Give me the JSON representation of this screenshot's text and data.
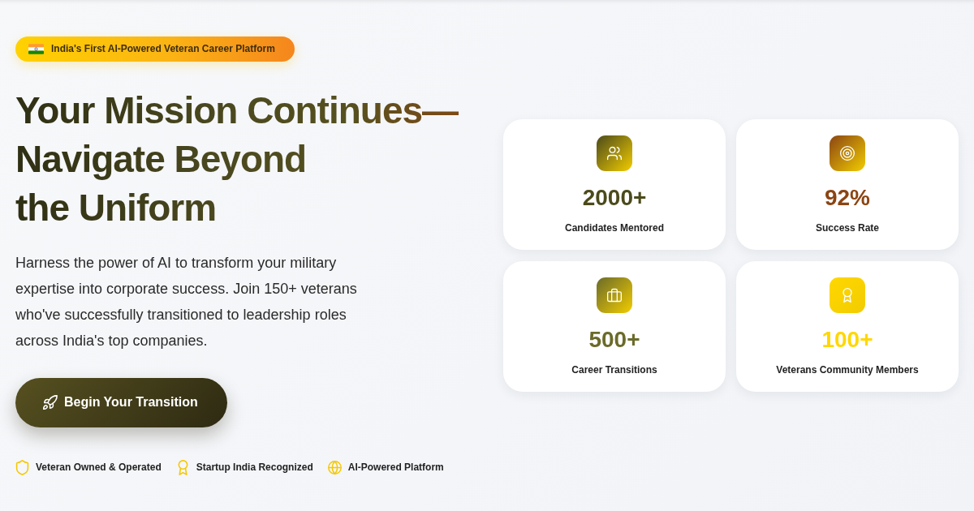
{
  "hero": {
    "badge": {
      "label": "India's First AI-Powered Veteran Career Platform"
    },
    "headline": [
      "Your Mission Continues—",
      "Navigate Beyond",
      "the Uniform"
    ],
    "description": "Harness the power of AI to transform your military expertise into corporate success. Join 150+ veterans who've successfully transitioned to leadership roles across India's top companies.",
    "cta": {
      "label": "Begin Your Transition"
    },
    "trust_items": [
      {
        "label": "Veteran Owned & Operated"
      },
      {
        "label": "Startup India Recognized"
      },
      {
        "label": "AI-Powered Platform"
      }
    ]
  },
  "stats": [
    {
      "value": "2000+",
      "label": "Candidates Mentored",
      "color": "#4b4a1b"
    },
    {
      "value": "92%",
      "label": "Success Rate",
      "color": "#8b4513"
    },
    {
      "value": "500+",
      "label": "Career Transitions",
      "color": "#6b6b2a"
    },
    {
      "value": "100+",
      "label": "Veterans Community Members",
      "color": "#ffd700"
    }
  ]
}
